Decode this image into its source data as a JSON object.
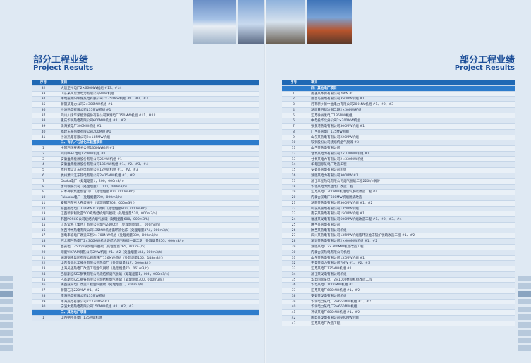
{
  "header": {
    "title_cn": "部分工程业绩",
    "title_en": "Project Results"
  },
  "table_head": {
    "no": "序号",
    "project": "项目"
  },
  "left_rows": [
    {
      "no": "32",
      "project": "大唐卫州电厂2×660MW机组 #13、#14",
      "type": "row"
    },
    {
      "no": "33",
      "project": "山东来宾思源电力有限公司8MW机组",
      "type": "row"
    },
    {
      "no": "34",
      "project": "中电投南阳环保热电有限公司2×350MW机组 #1、#2、#3",
      "type": "row"
    },
    {
      "no": "35",
      "project": "新疆某电力公司2×300MW机组 #1",
      "type": "row"
    },
    {
      "no": "36",
      "project": "沙洲热电有限公司135MW机组 #1",
      "type": "row"
    },
    {
      "no": "37",
      "project": "四川川煤华荣能源股份有限公司洪湖电厂150MW机组 #11、#12",
      "type": "row"
    },
    {
      "no": "38",
      "project": "重庆华润热电有限公司600MW机组 #1、#2",
      "type": "row"
    },
    {
      "no": "39",
      "project": "珠海某电厂300MW机组 #1",
      "type": "row"
    },
    {
      "no": "40",
      "project": "福建东海热电有限公司200MW #1",
      "type": "row"
    },
    {
      "no": "41",
      "project": "沙洲热电有限公司2×135MW机组",
      "type": "row"
    },
    {
      "no": "",
      "project": "二、有机／石油化工装置项目",
      "type": "sect"
    },
    {
      "no": "1",
      "project": "中国石化安庆分公司135MW机组 #1",
      "type": "row"
    },
    {
      "no": "2",
      "project": "四川PPFL电站125MW机组 #1",
      "type": "row"
    },
    {
      "no": "3",
      "project": "安徽淮南能源股份有限公司25MW机组 #1",
      "type": "row"
    },
    {
      "no": "4",
      "project": "安徽淮南能源股份有限公司135MW机组 #1、#2、#3、#4",
      "type": "row"
    },
    {
      "no": "5",
      "project": "杭州萧山江东热电有限公司12MW机组 #1、#2、#3",
      "type": "row"
    },
    {
      "no": "6",
      "project": "杭州萧山江东热电有限公司2×15MW机组 #1、#2",
      "type": "row"
    },
    {
      "no": "7",
      "project": "Osaka电厂（处理烟量1，200，000m3/h）",
      "type": "row"
    },
    {
      "no": "8",
      "project": "唐山钢铁公司（处理烟量1，000，000m3/h）",
      "type": "row"
    },
    {
      "no": "9",
      "project": "日本神钢集团加古川厂（处理烟量700，000m3/h）",
      "type": "row"
    },
    {
      "no": "10",
      "project": "Fukuoka电厂（处理烟量720，000m3/h）",
      "type": "row"
    },
    {
      "no": "11",
      "project": "安钢石灰窑大布袋除尘（处理烟量708，000m3/h）",
      "type": "row"
    },
    {
      "no": "12",
      "project": "泰国南电电厂710MWTCR项目（处理烟量800，000m3/h）",
      "type": "row"
    },
    {
      "no": "13",
      "project": "江西新钢利比亚500吨烧结机烟气脱硫（处理烟量520，000m3/h）",
      "type": "row"
    },
    {
      "no": "14",
      "project": "韩国POSCO公司烧结机烟气脱硫（处理烟量600，000m3/h）",
      "type": "row"
    },
    {
      "no": "15",
      "project": "江苏常熟（集团）有限公司烟气2400t/h（处理烟量481，000m3/h）",
      "type": "row"
    },
    {
      "no": "16",
      "project": "陕西神木热电有限公司135MW机组循环流化床（处理烟量374，000m3/h）",
      "type": "row"
    },
    {
      "no": "17",
      "project": "国电丰城电厂改造工程2×700MW机组（处理烟量330，000m3/h）",
      "type": "row"
    },
    {
      "no": "18",
      "project": "河北邢台热电厂2×300MW机组烧结机烟气脱硫一期二期（处理烟量205，000m3/h）",
      "type": "row"
    },
    {
      "no": "19",
      "project": "西安电厂750t/h锅炉烟气脱硫（处理烟量265，000m3/h）",
      "type": "row"
    },
    {
      "no": "20",
      "project": "印度VIKRAM钢铁公司2MW机组 #1、#2（处理烟量184，000m3/h）",
      "type": "row"
    },
    {
      "no": "21",
      "project": "湘潭钢铁集团有限公司炼铁厂136MW机组（处理烟量155，148m3/h）",
      "type": "row"
    },
    {
      "no": "22",
      "project": "山东鲁北化工股份有限公司热电厂（处理烟量217，000m3/h）",
      "type": "row"
    },
    {
      "no": "23",
      "project": "上海吴泾热电厂改造工程烟气脱硫（处理烟量70，061m3/h）",
      "type": "row"
    },
    {
      "no": "24",
      "project": "巴基斯坦PZC钢铁有限公司烧结机烟气脱硫（处理烟量1，008，000m3/h）",
      "type": "row"
    },
    {
      "no": "25",
      "project": "巴基斯坦PZC钢铁有限公司烧结机烟气脱硫（处理烟量300，000m3/h）",
      "type": "row"
    },
    {
      "no": "26",
      "project": "陕西咸阳电厂改造工程烟气脱硫（处理烟量1，800m3/h）",
      "type": "row"
    },
    {
      "no": "27",
      "project": "新疆石化220MW #1、#2",
      "type": "row"
    },
    {
      "no": "28",
      "project": "南海热电有限公司135MW机组",
      "type": "row"
    },
    {
      "no": "29",
      "project": "南海热电有限公司2×250MW #1",
      "type": "row"
    },
    {
      "no": "30",
      "project": "宁波大港热电有限公司150MW机组 #1、#2、#3",
      "type": "row"
    },
    {
      "no": "",
      "project": "三、其他电厂项目",
      "type": "sect"
    },
    {
      "no": "1",
      "project": "山西朔州某电厂135MW机组",
      "type": "row"
    }
  ],
  "right_rows": [
    {
      "no": "",
      "project": "四、其他电厂项目",
      "type": "sect"
    },
    {
      "no": "1",
      "project": "南通某环保有限公司7MW #1",
      "type": "row"
    },
    {
      "no": "2",
      "project": "秦皇岛热电有限公司350MW机组 #1",
      "type": "row"
    },
    {
      "no": "3",
      "project": "河南新乡新中益电力有限公司200MW机组 #1、#2、#3",
      "type": "row"
    },
    {
      "no": "4",
      "project": "湖北黄石新冶钢二期2×50MW机组",
      "type": "row"
    },
    {
      "no": "5",
      "project": "江苏徐州发电厂135MW机组",
      "type": "row"
    },
    {
      "no": "6",
      "project": "中电投华北分公司2×300MW机组",
      "type": "row"
    },
    {
      "no": "7",
      "project": "张家港热电有限公司300MW机组 #1",
      "type": "row"
    },
    {
      "no": "8",
      "project": "广西某热电厂135MW机组",
      "type": "row"
    },
    {
      "no": "9",
      "project": "山东某热电有限公司220MW机组",
      "type": "row"
    },
    {
      "no": "10",
      "project": "鞍钢股份公司烧结机烟气脱硫 #3",
      "type": "row"
    },
    {
      "no": "11",
      "project": "山西某热电有限公司",
      "type": "row"
    },
    {
      "no": "12",
      "project": "甘肃某电力有限公司2×330MW机组 #1",
      "type": "row"
    },
    {
      "no": "13",
      "project": "甘肃某电力有限公司2×330MW机组",
      "type": "row"
    },
    {
      "no": "14",
      "project": "华电国际某电厂改造工程",
      "type": "row"
    },
    {
      "no": "15",
      "project": "安徽某热电有限公司机组",
      "type": "row"
    },
    {
      "no": "16",
      "project": "湖北某电力有限公司300MW #1",
      "type": "row"
    },
    {
      "no": "17",
      "project": "浙江三星热电有限公司烟气脱硫工程220t/h锅炉",
      "type": "row"
    },
    {
      "no": "18",
      "project": "华北某电力集团电厂改造工程",
      "type": "row"
    },
    {
      "no": "19",
      "project": "江苏某电厂300MW机组烟气脱硫改造工程 #4",
      "type": "row"
    },
    {
      "no": "20",
      "project": "内蒙古某电厂600MW机组脱硫改造",
      "type": "row"
    },
    {
      "no": "21",
      "project": "湖南某热电有限公司300MW机组 #1、#2",
      "type": "row"
    },
    {
      "no": "22",
      "project": "山东某热电有限公司135MW机组",
      "type": "row"
    },
    {
      "no": "23",
      "project": "南宁某热电有限公司150MW机组 #1",
      "type": "row"
    },
    {
      "no": "24",
      "project": "福建某发电有限公司600MW机组改造工程 #1、#2、#3、#4",
      "type": "row"
    },
    {
      "no": "25",
      "project": "陕西某热电有限公司",
      "type": "row"
    },
    {
      "no": "26",
      "project": "陕西某热电有限公司机组",
      "type": "row"
    },
    {
      "no": "27",
      "project": "四川某热电有限公司135MW机组循环流化床锅炉脱硫改造工程 #1、#2",
      "type": "row"
    },
    {
      "no": "28",
      "project": "深圳某热电有限公司2×600MW机组 #1、#2",
      "type": "row"
    },
    {
      "no": "29",
      "project": "湖北某电厂2×300MW机组改造工程",
      "type": "row"
    },
    {
      "no": "30",
      "project": "内蒙古某热电有限公司机组",
      "type": "row"
    },
    {
      "no": "31",
      "project": "山东某热电有限公司135MW机组 #1",
      "type": "row"
    },
    {
      "no": "32",
      "project": "宁夏某电力有限公司7MW #1、#2、#3",
      "type": "row"
    },
    {
      "no": "33",
      "project": "江苏某电厂135MW机组 #1",
      "type": "row"
    },
    {
      "no": "34",
      "project": "浙江某发电有限公司机组",
      "type": "row"
    },
    {
      "no": "35",
      "project": "华电国际某电厂2×1000MW机组改造工程",
      "type": "row"
    },
    {
      "no": "36",
      "project": "华电某电厂1000MW机组 #1",
      "type": "row"
    },
    {
      "no": "37",
      "project": "江苏某电厂600MW机组 #1、#2",
      "type": "row"
    },
    {
      "no": "38",
      "project": "安徽某发电有限公司机组",
      "type": "row"
    },
    {
      "no": "39",
      "project": "华润电力某电厂2×660MW机组 #1、#2",
      "type": "row"
    },
    {
      "no": "40",
      "project": "华润电力某电厂2×660MW机组",
      "type": "row"
    },
    {
      "no": "41",
      "project": "神华某电厂600MW机组 #1、#2",
      "type": "row"
    },
    {
      "no": "42",
      "project": "国电某发电有限公司600MW机组",
      "type": "row"
    },
    {
      "no": "43",
      "project": "江苏某电厂改造工程",
      "type": "row"
    }
  ]
}
